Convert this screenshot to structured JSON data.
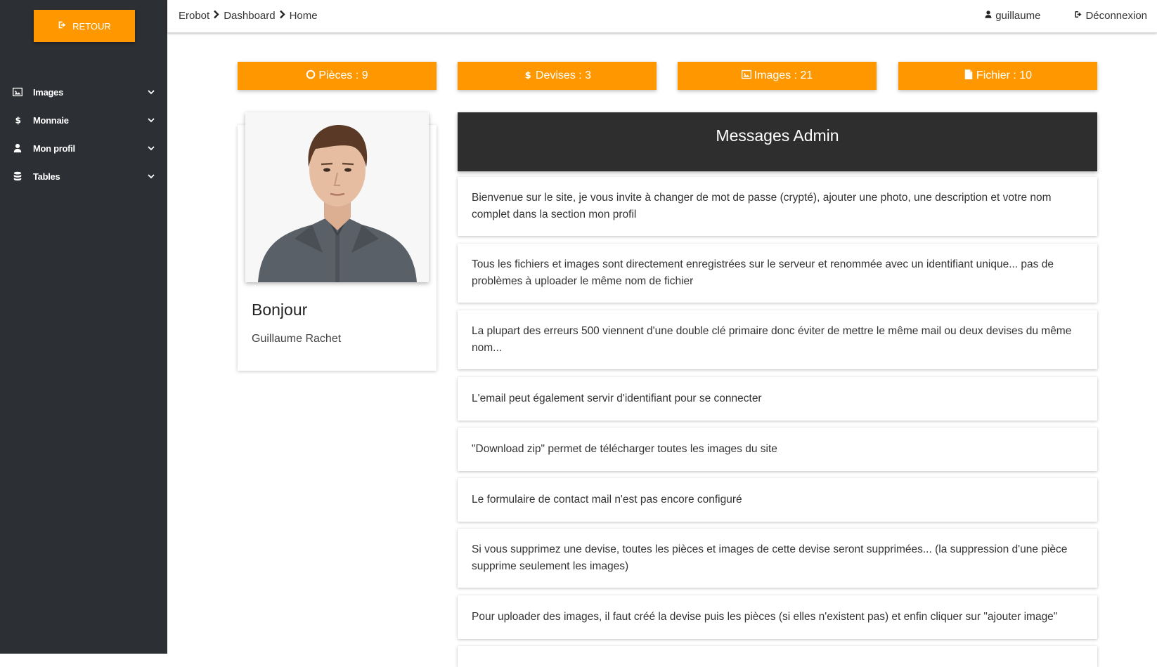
{
  "sidebar": {
    "retour_label": "RETOUR",
    "items": [
      {
        "label": "Images",
        "icon": "image-icon"
      },
      {
        "label": "Monnaie",
        "icon": "dollar-icon"
      },
      {
        "label": "Mon profil",
        "icon": "user-icon"
      },
      {
        "label": "Tables",
        "icon": "database-icon"
      }
    ]
  },
  "topbar": {
    "breadcrumb": [
      "Erobot",
      "Dashboard",
      "Home"
    ],
    "username": "guillaume",
    "logout_label": "Déconnexion"
  },
  "stats": [
    {
      "label": "Pièces : 9",
      "icon": "circle-icon"
    },
    {
      "label": "Devises : 3",
      "icon": "dollar-icon"
    },
    {
      "label": "Images : 21",
      "icon": "image-icon"
    },
    {
      "label": "Fichier : 10",
      "icon": "file-icon"
    }
  ],
  "profile": {
    "greeting": "Bonjour",
    "name": "Guillaume Rachet"
  },
  "messages": {
    "title": "Messages Admin",
    "items": [
      "Bienvenue sur le site, je vous invite à changer de mot de passe (crypté), ajouter une photo, une description et votre nom complet dans la section mon profil",
      "Tous les fichiers et images sont directement enregistrées sur le serveur et renommée avec un identifiant unique... pas de problèmes à uploader le même nom de fichier",
      "La plupart des erreurs 500 viennent d'une double clé primaire donc éviter de mettre le même mail ou deux devises du même nom...",
      "L'email peut également servir d'identifiant pour se connecter",
      "\"Download zip\" permet de télécharger toutes les images du site",
      "Le formulaire de contact mail n'est pas encore configuré",
      "Si vous supprimez une devise, toutes les pièces et images de cette devise seront supprimées... (la suppression d'une pièce supprime seulement les images)",
      "Pour uploader des images, il faut créé la devise puis les pièces (si elles n'existent pas) et enfin cliquer sur \"ajouter image\""
    ]
  },
  "colors": {
    "accent": "#ff9800",
    "sidebar_bg": "#2c2f33",
    "header_dark": "#2e2e2e"
  }
}
